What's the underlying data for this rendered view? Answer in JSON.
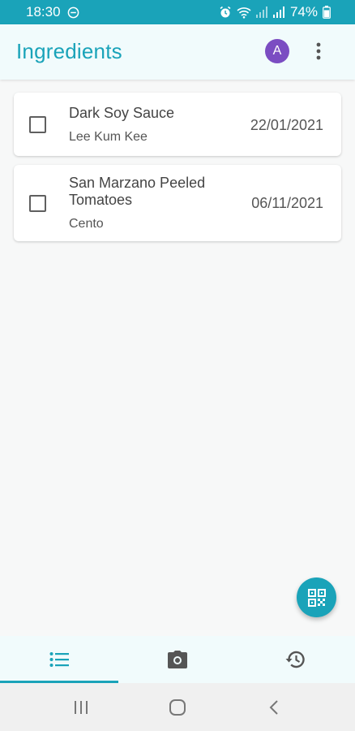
{
  "status_bar": {
    "time": "18:30",
    "battery": "74%"
  },
  "app_bar": {
    "title": "Ingredients",
    "avatar_initial": "A"
  },
  "items": [
    {
      "name": "Dark Soy Sauce",
      "brand": "Lee Kum Kee",
      "date": "22/01/2021",
      "checked": false
    },
    {
      "name": "San Marzano Peeled Tomatoes",
      "brand": "Cento",
      "date": "06/11/2021",
      "checked": false
    }
  ],
  "bottom_nav": {
    "tabs": [
      {
        "icon": "list-icon",
        "active": true
      },
      {
        "icon": "camera-icon",
        "active": false
      },
      {
        "icon": "history-icon",
        "active": false
      }
    ]
  },
  "fab": {
    "icon": "qr-code-icon"
  },
  "colors": {
    "primary": "#1aa3b9",
    "avatar": "#7b4dc2",
    "app_bar_bg": "#f1fbfc",
    "page_bg": "#f7f8f8"
  }
}
